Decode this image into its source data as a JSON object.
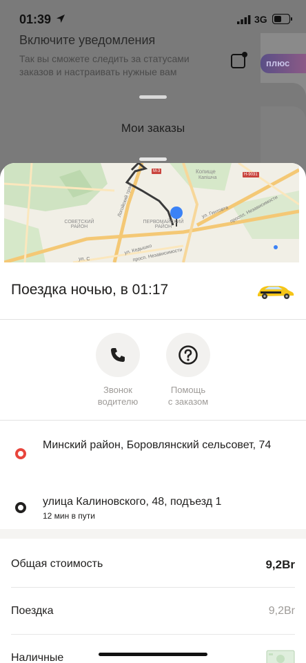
{
  "status": {
    "time": "01:39",
    "network": "3G"
  },
  "notification": {
    "title": "Включите уведомления",
    "text": "Так вы сможете следить за статусами заказов и настраивать нужные вам оповещения",
    "plus_badge": "плюс"
  },
  "orders": {
    "title": "Мои заказы"
  },
  "map": {
    "districts": [
      "СОВЕТСКИЙ РАЙОН",
      "ПЕРВОМАЙСКИЙ РАЙОН"
    ],
    "places": [
      "Копище",
      "Капішча"
    ],
    "roads": [
      "ул. Гинтовта",
      "проспл. Независимости",
      "Логойский тракт",
      "ул. Кедышко",
      "просп. Независимости",
      "ул. С"
    ],
    "route_badges": [
      "М-3",
      "Н-9031"
    ]
  },
  "trip": {
    "title": "Поездка ночью, в 01:17"
  },
  "actions": [
    {
      "label": "Звонок\nводителю",
      "icon": "phone-icon"
    },
    {
      "label": "Помощь\nс заказом",
      "icon": "help-icon"
    }
  ],
  "route": {
    "from": {
      "address": "Минский район, Боровлянский сельсовет, 74",
      "color": "#e8453c"
    },
    "to": {
      "address": "улица Калиновского, 48, подъезд 1",
      "eta": "12 мин в пути",
      "color": "#21201f"
    }
  },
  "price": {
    "total_label": "Общая стоимость",
    "total_value": "9,2Br",
    "ride_label": "Поездка",
    "ride_value": "9,2Br",
    "payment_label": "Наличные"
  },
  "colors": {
    "accent_blue": "#3b82f6",
    "taxi_yellow": "#f5c518",
    "pickup_red": "#e8453c"
  }
}
